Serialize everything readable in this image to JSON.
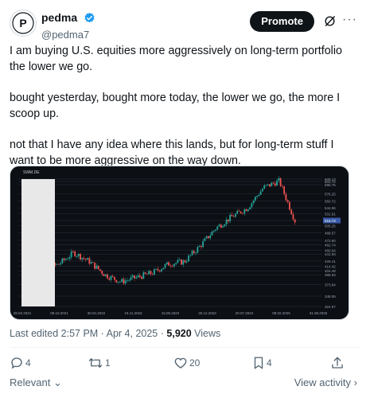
{
  "author": {
    "display_name": "pedma",
    "handle": "@pedma7",
    "avatar_letter": "P",
    "verified_color": "#1d9bf0"
  },
  "header": {
    "promote_label": "Promote",
    "grok_icon": "grok-icon",
    "more_icon": "more-icon"
  },
  "post": {
    "paragraphs": [
      "I am buying U.S. equities more aggressively on long-term portfolio the lower we go.",
      "bought yesterday, bought more today, the lower we go, the more I scoop up.",
      "not that I have any idea where this lands, but for long-term stuff I want to be more aggressive on the way down."
    ]
  },
  "chart_image": {
    "symbol_label": "SWM.DE",
    "x_ticks": [
      "28.03.2021",
      "09.10.2021",
      "30.04.2022",
      "19.11.2022",
      "15.05.2023",
      "30.12.2023",
      "20.07.2024",
      "08.02.2025",
      "31.08.2025"
    ],
    "y_ticks": [
      "609.13",
      "603.74",
      "596.75",
      "576.25",
      "560.72",
      "544.96",
      "531.91",
      "516.75",
      "505.25",
      "489.57",
      "472.60",
      "462.74",
      "450.04",
      "441.93",
      "426.41",
      "414.42",
      "404.49",
      "395.63",
      "373.84",
      "348.06",
      "324.97"
    ],
    "last_price_label": "516.73",
    "colors": {
      "up": "#26a69a",
      "down": "#ef5350",
      "background": "#0c0f14",
      "price_tag": "#3a5ba8"
    }
  },
  "chart_data": {
    "type": "candlestick",
    "x": [
      "2021-03",
      "2021-06",
      "2021-09",
      "2021-12",
      "2022-03",
      "2022-06",
      "2022-09",
      "2022-12",
      "2023-03",
      "2023-06",
      "2023-09",
      "2023-12",
      "2024-03",
      "2024-06",
      "2024-09",
      "2024-12",
      "2025-02",
      "2025-04"
    ],
    "close": [
      395,
      410,
      418,
      445,
      425,
      395,
      380,
      390,
      400,
      420,
      425,
      460,
      500,
      525,
      545,
      590,
      605,
      516
    ],
    "ylim": [
      324.97,
      609.13
    ]
  },
  "meta": {
    "edited_prefix": "Last edited",
    "timestamp": "2:57 PM · Apr 4, 2025",
    "separator": "·",
    "views_count": "5,920",
    "views_label": "Views"
  },
  "actions": {
    "replies": "4",
    "reposts": "1",
    "likes": "20",
    "bookmarks": "4"
  },
  "footer": {
    "sort_label": "Relevant",
    "view_activity_label": "View activity"
  }
}
